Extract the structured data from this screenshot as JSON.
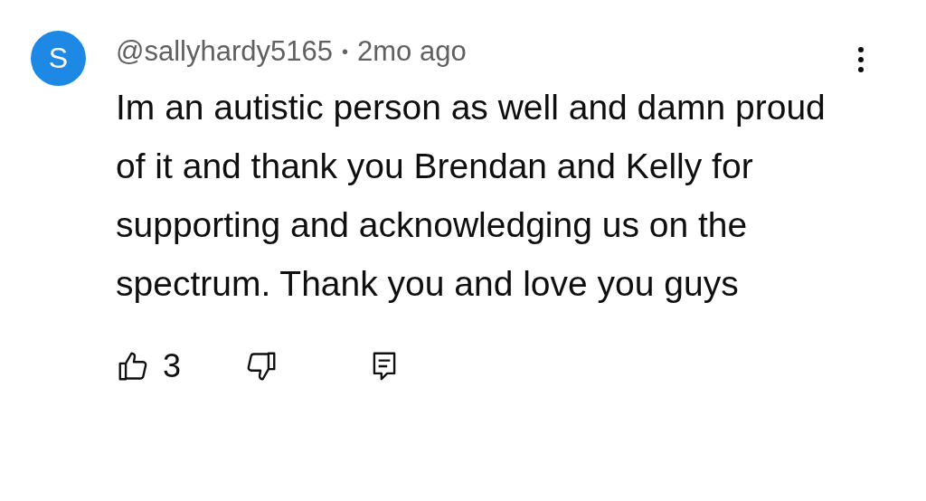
{
  "comment": {
    "avatar_letter": "S",
    "author": "@sallyhardy5165",
    "separator": "•",
    "time": "2mo ago",
    "text": "Im an autistic person as well and damn proud of it and thank you Brendan and Kelly for supporting and acknowledging us on the spectrum. Thank you and love you guys",
    "like_count": "3"
  }
}
